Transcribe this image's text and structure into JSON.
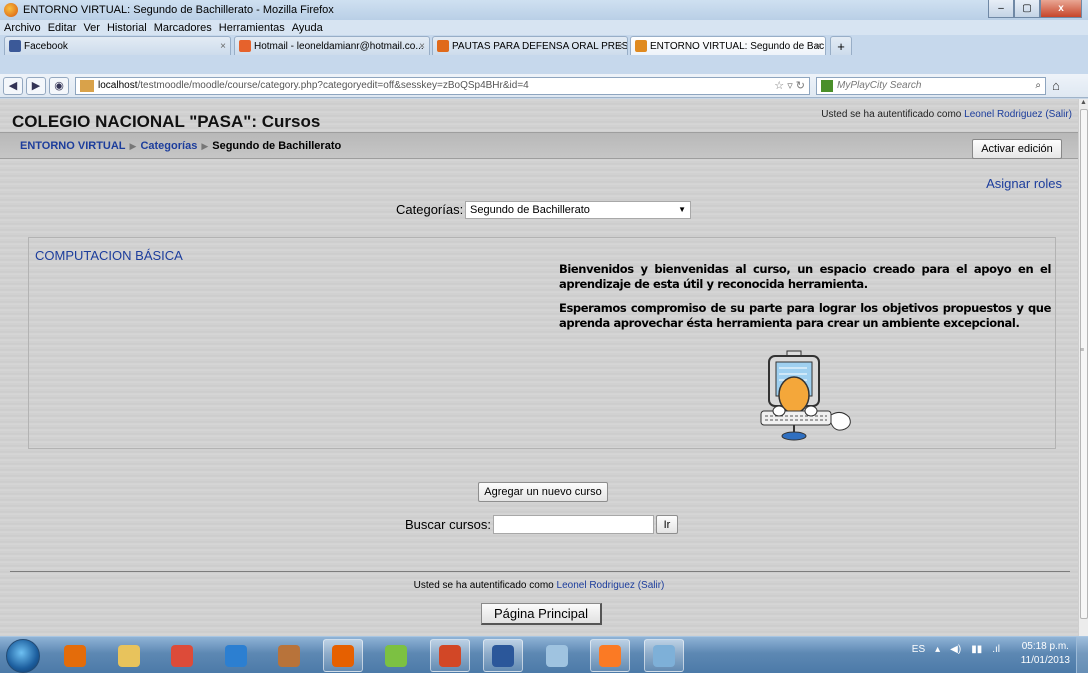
{
  "window": {
    "title": "ENTORNO VIRTUAL: Segundo de Bachillerato - Mozilla Firefox",
    "controls": {
      "minimize": "–",
      "maximize": "▢",
      "close": "x"
    }
  },
  "menu": [
    "Archivo",
    "Editar",
    "Ver",
    "Historial",
    "Marcadores",
    "Herramientas",
    "Ayuda"
  ],
  "tabs": [
    {
      "label": "Facebook",
      "icon": "facebook-icon",
      "color": "#3b5998",
      "active": false
    },
    {
      "label": "Hotmail - leoneldamianr@hotmail.co...",
      "icon": "hotmail-icon",
      "color": "#e6622c",
      "active": false
    },
    {
      "label": "PAUTAS PARA DEFENSA ORAL PRESE...",
      "icon": "blogger-icon",
      "color": "#e06a1b",
      "active": false
    },
    {
      "label": "ENTORNO VIRTUAL: Segundo de Bac...",
      "icon": "moodle-icon",
      "color": "#e08a1f",
      "active": true
    }
  ],
  "tab_new": "+",
  "address": {
    "host": "localhost",
    "path": "/testmoodle/moodle/course/category.php?categoryedit=off&sesskey=zBoQSp4BHr&id=4"
  },
  "search_box": {
    "placeholder": "MyPlayCity Search"
  },
  "page": {
    "site_title": "COLEGIO NACIONAL \"PASA\": Cursos",
    "login_prefix": "Usted se ha autentificado como",
    "login_user": "Leonel Rodriguez",
    "login_logout": "(Salir)",
    "breadcrumb": [
      "ENTORNO VIRTUAL",
      "Categorías",
      "Segundo de Bachillerato"
    ],
    "breadcrumb_sep": "▶",
    "edit_button": "Activar edición",
    "assign_roles": "Asignar roles",
    "category_label": "Categorías:",
    "category_selected": "Segundo de Bachillerato",
    "course": {
      "name": "COMPUTACION BÁSICA",
      "summary": [
        "Bienvenidos y bienvenidas al curso, un espacio creado para el apoyo en el aprendizaje de esta útil y reconocida herramienta.",
        "Esperamos compromiso de su parte para lograr los objetivos propuestos y que aprenda aprovechar ésta herramienta para crear un ambiente excepcional."
      ]
    },
    "add_course_button": "Agregar un nuevo curso",
    "search_label": "Buscar cursos:",
    "search_value": "",
    "search_go": "Ir",
    "home_button": "Página Principal"
  },
  "taskbar": {
    "items": [
      {
        "name": "outlook-icon",
        "color": "#e46c0a",
        "open": false
      },
      {
        "name": "file-explorer-icon",
        "color": "#e8c35c",
        "open": false
      },
      {
        "name": "chrome-icon",
        "color": "#dd4b39",
        "open": false
      },
      {
        "name": "camera-icon",
        "color": "#2c7fd1",
        "open": false
      },
      {
        "name": "media-app-icon",
        "color": "#b8733a",
        "open": false
      },
      {
        "name": "firefox-icon",
        "color": "#e66000",
        "open": true
      },
      {
        "name": "contacts-icon",
        "color": "#7cc142",
        "open": false
      },
      {
        "name": "powerpoint-icon",
        "color": "#d24726",
        "open": true
      },
      {
        "name": "word-icon",
        "color": "#2b579a",
        "open": true
      },
      {
        "name": "paint-icon",
        "color": "#9fc3e0",
        "open": false
      },
      {
        "name": "xampp-icon",
        "color": "#fb7a24",
        "open": true
      },
      {
        "name": "note-app-icon",
        "color": "#7eb0d8",
        "open": true
      }
    ],
    "lang": "ES",
    "time": "05:18 p.m.",
    "date": "11/01/2013"
  }
}
